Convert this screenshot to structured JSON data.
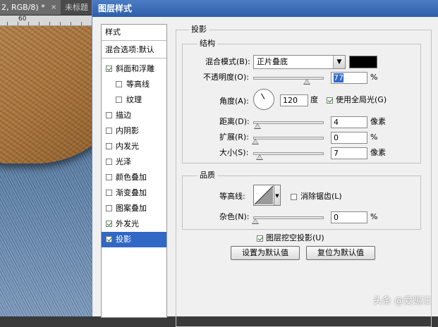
{
  "document": {
    "tab_title": "2, RGB/8) *",
    "tab_close": "×",
    "tab_inactive": "未标题",
    "ruler_label": "60"
  },
  "dialog": {
    "title": "图层样式",
    "styles_header": "样式",
    "blend_options": "混合选项:默认",
    "style_items": [
      {
        "label": "斜面和浮雕",
        "checked": true
      },
      {
        "label": "等高线",
        "checked": false
      },
      {
        "label": "纹理",
        "checked": false
      },
      {
        "label": "描边",
        "checked": false
      },
      {
        "label": "内阴影",
        "checked": false
      },
      {
        "label": "内发光",
        "checked": false
      },
      {
        "label": "光泽",
        "checked": false
      },
      {
        "label": "颜色叠加",
        "checked": false
      },
      {
        "label": "渐变叠加",
        "checked": false
      },
      {
        "label": "图案叠加",
        "checked": false
      },
      {
        "label": "外发光",
        "checked": true
      },
      {
        "label": "投影",
        "checked": true,
        "selected": true
      }
    ]
  },
  "drop_shadow": {
    "section_title": "投影",
    "structure": {
      "title": "结构",
      "blend_mode_label": "混合模式(B):",
      "blend_mode_value": "正片叠底",
      "shadow_color": "#000000",
      "opacity_label": "不透明度(O):",
      "opacity_value": "77",
      "opacity_unit": "%",
      "angle_label": "角度(A):",
      "angle_value": "120",
      "angle_unit": "度",
      "global_light_label": "使用全局光(G)",
      "global_light_checked": true,
      "distance_label": "距离(D):",
      "distance_value": "4",
      "distance_unit": "像素",
      "spread_label": "扩展(R):",
      "spread_value": "0",
      "spread_unit": "%",
      "size_label": "大小(S):",
      "size_value": "7",
      "size_unit": "像素"
    },
    "quality": {
      "title": "品质",
      "contour_label": "等高线:",
      "anti_alias_label": "消除锯齿(L)",
      "anti_alias_checked": false,
      "noise_label": "杂色(N):",
      "noise_value": "0",
      "noise_unit": "%"
    },
    "knockout_label": "图层挖空投影(U)",
    "knockout_checked": true,
    "make_default_label": "设置为默认值",
    "reset_default_label": "复位为默认值"
  },
  "watermark": "头条 @爱踢汪"
}
